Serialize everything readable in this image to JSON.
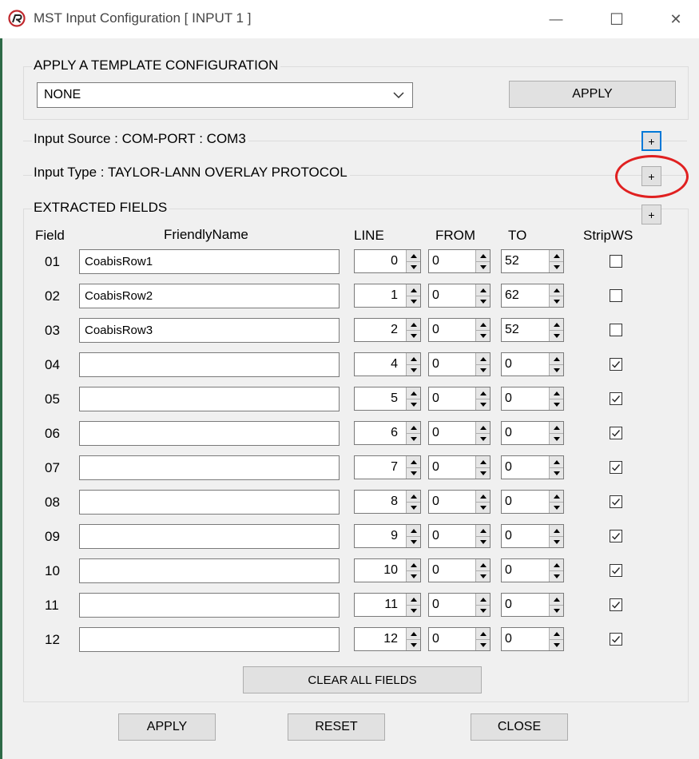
{
  "window": {
    "title": "MST Input Configuration [ INPUT 1 ]",
    "minimize_glyph": "—",
    "maximize_glyph": "☐",
    "close_glyph": "✕"
  },
  "template": {
    "group_label": "APPLY A TEMPLATE CONFIGURATION",
    "selected": "NONE",
    "apply_label": "APPLY"
  },
  "input_source": {
    "label": "Input Source : COM-PORT : COM3",
    "expand_label": "+"
  },
  "input_type": {
    "label": "Input Type : TAYLOR-LANN OVERLAY PROTOCOL",
    "expand_label": "+"
  },
  "extracted": {
    "group_label": "EXTRACTED FIELDS",
    "expand_label": "+",
    "headers": {
      "field": "Field",
      "name": "FriendlyName",
      "line": "LINE",
      "from": "FROM",
      "to": "TO",
      "strip": "StripWS"
    },
    "rows": [
      {
        "field": "01",
        "name": "CoabisRow1",
        "line": "0",
        "from": "0",
        "to": "52",
        "strip": false
      },
      {
        "field": "02",
        "name": "CoabisRow2",
        "line": "1",
        "from": "0",
        "to": "62",
        "strip": false
      },
      {
        "field": "03",
        "name": "CoabisRow3",
        "line": "2",
        "from": "0",
        "to": "52",
        "strip": false
      },
      {
        "field": "04",
        "name": "",
        "line": "4",
        "from": "0",
        "to": "0",
        "strip": true
      },
      {
        "field": "05",
        "name": "",
        "line": "5",
        "from": "0",
        "to": "0",
        "strip": true
      },
      {
        "field": "06",
        "name": "",
        "line": "6",
        "from": "0",
        "to": "0",
        "strip": true
      },
      {
        "field": "07",
        "name": "",
        "line": "7",
        "from": "0",
        "to": "0",
        "strip": true
      },
      {
        "field": "08",
        "name": "",
        "line": "8",
        "from": "0",
        "to": "0",
        "strip": true
      },
      {
        "field": "09",
        "name": "",
        "line": "9",
        "from": "0",
        "to": "0",
        "strip": true
      },
      {
        "field": "10",
        "name": "",
        "line": "10",
        "from": "0",
        "to": "0",
        "strip": true
      },
      {
        "field": "11",
        "name": "",
        "line": "11",
        "from": "0",
        "to": "0",
        "strip": true
      },
      {
        "field": "12",
        "name": "",
        "line": "12",
        "from": "0",
        "to": "0",
        "strip": true
      }
    ],
    "clear_label": "CLEAR ALL FIELDS"
  },
  "footer": {
    "apply_label": "APPLY",
    "reset_label": "RESET",
    "close_label": "CLOSE"
  },
  "colors": {
    "focus_blue": "#0078d7",
    "annotation_red": "#e02020",
    "frame_green": "#2d6a47"
  }
}
